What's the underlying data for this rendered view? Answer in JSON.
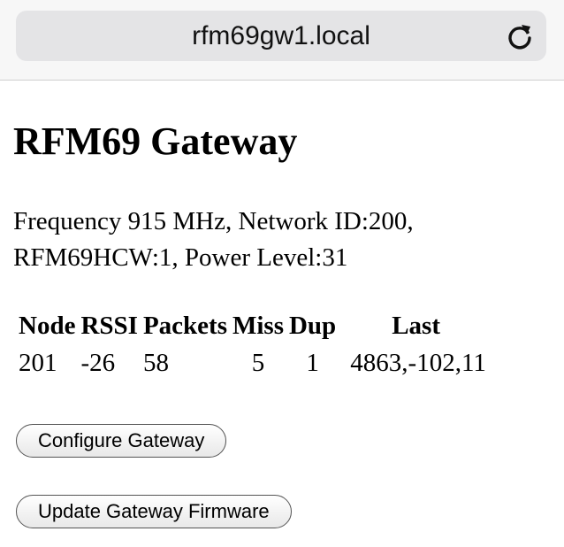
{
  "browser": {
    "url": "rfm69gw1.local"
  },
  "page": {
    "title": "RFM69 Gateway",
    "info_line1": "Frequency 915 MHz, Network ID:200,",
    "info_line2": "RFM69HCW:1, Power Level:31"
  },
  "table": {
    "headers": {
      "node": "Node",
      "rssi": "RSSI",
      "packets": "Packets",
      "miss": "Miss",
      "dup": "Dup",
      "last": "Last"
    },
    "rows": [
      {
        "node": "201",
        "rssi": "-26",
        "packets": "58",
        "miss": "5",
        "dup": "1",
        "last": "4863,-102,11"
      }
    ]
  },
  "buttons": {
    "configure": "Configure Gateway",
    "update": "Update Gateway Firmware"
  }
}
